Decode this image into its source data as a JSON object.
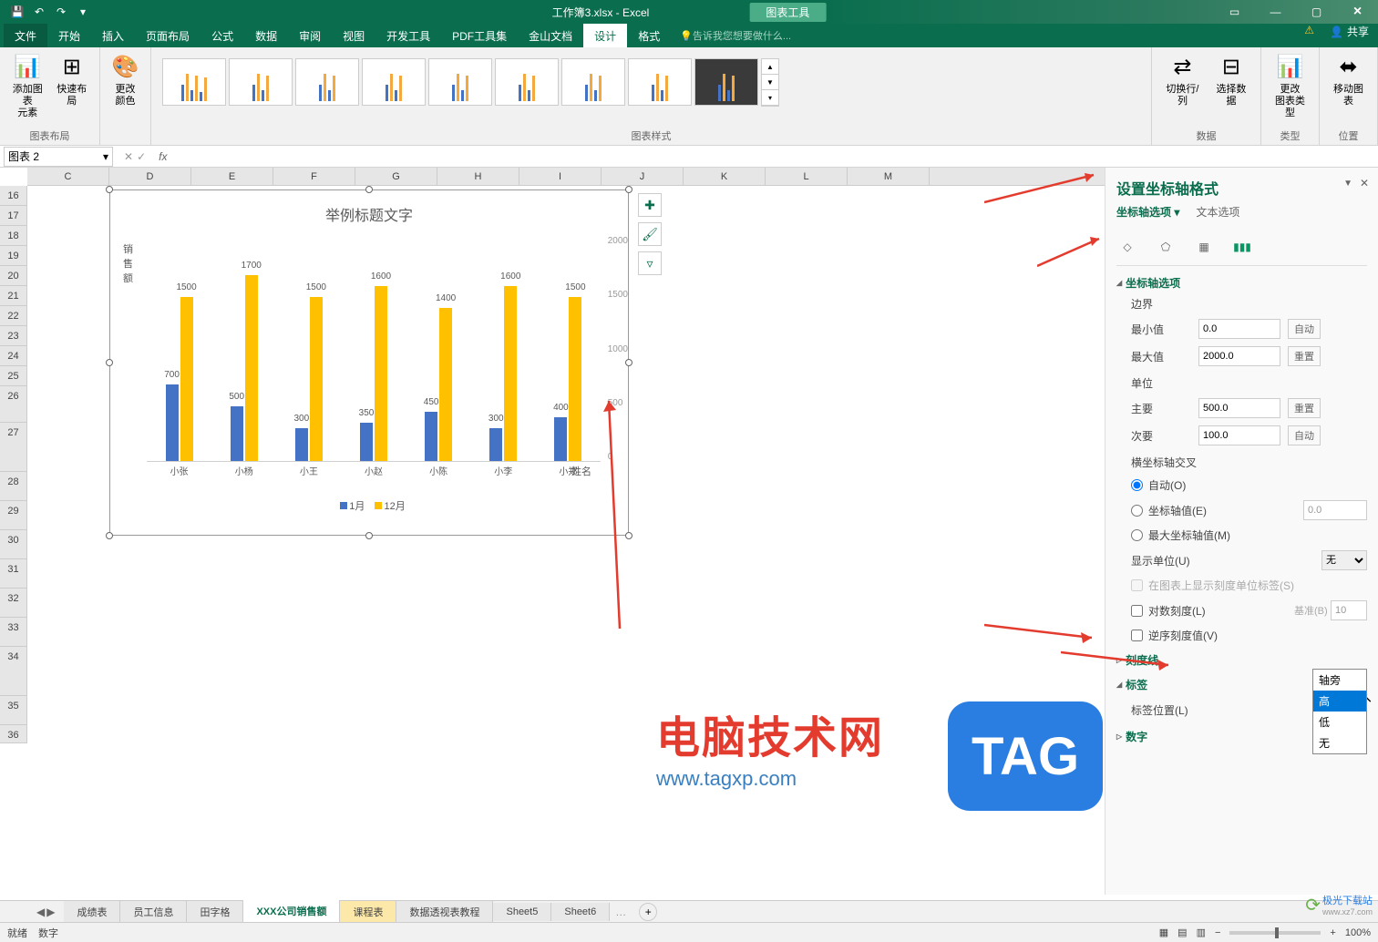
{
  "title_bar": {
    "file_name": "工作簿3.xlsx - Excel",
    "context_tab": "图表工具"
  },
  "ribbon_tabs": [
    "文件",
    "开始",
    "插入",
    "页面布局",
    "公式",
    "数据",
    "审阅",
    "视图",
    "开发工具",
    "PDF工具集",
    "金山文档",
    "设计",
    "格式"
  ],
  "ribbon_active": "设计",
  "tell_me": "告诉我您想要做什么...",
  "share_label": "共享",
  "ribbon": {
    "add_element": "添加图表\n元素",
    "quick_layout": "快速布局",
    "change_color": "更改\n颜色",
    "group_layout": "图表布局",
    "group_style": "图表样式",
    "switch_rc": "切换行/列",
    "select_data": "选择数据",
    "group_data": "数据",
    "change_type": "更改\n图表类型",
    "group_type": "类型",
    "move_chart": "移动图表",
    "group_loc": "位置"
  },
  "name_box": "图表 2",
  "chart_data": {
    "type": "bar",
    "title": "举例标题文字",
    "ylabel": "销\n售\n额",
    "xlabel": "姓名",
    "categories": [
      "小张",
      "小杨",
      "小王",
      "小赵",
      "小陈",
      "小李",
      "小郑"
    ],
    "series": [
      {
        "name": "1月",
        "values": [
          700,
          500,
          300,
          350,
          450,
          300,
          400
        ],
        "color": "#4472c4"
      },
      {
        "name": "12月",
        "values": [
          1500,
          1700,
          1500,
          1600,
          1400,
          1600,
          1500
        ],
        "color": "#ffc000"
      }
    ],
    "ylim": [
      0,
      2000
    ],
    "yticks": [
      0,
      500,
      1000,
      1500,
      2000
    ]
  },
  "format_pane": {
    "title": "设置坐标轴格式",
    "subtab1": "坐标轴选项",
    "subtab2": "文本选项",
    "section_axis": "坐标轴选项",
    "bounds": "边界",
    "min": "最小值",
    "min_val": "0.0",
    "min_aux": "自动",
    "max": "最大值",
    "max_val": "2000.0",
    "max_aux": "重置",
    "unit": "单位",
    "major": "主要",
    "major_val": "500.0",
    "major_aux": "重置",
    "minor": "次要",
    "minor_val": "100.0",
    "minor_aux": "自动",
    "hcross": "横坐标轴交叉",
    "auto_o": "自动(O)",
    "axis_val_e": "坐标轴值(E)",
    "axis_val_e_val": "0.0",
    "max_axis_m": "最大坐标轴值(M)",
    "disp_unit": "显示单位(U)",
    "disp_unit_val": "无",
    "show_unit_on_chart": "在图表上显示刻度单位标签(S)",
    "log_scale": "对数刻度(L)",
    "log_base_lbl": "基准(B)",
    "log_base": "10",
    "rev_order": "逆序刻度值(V)",
    "section_ticks": "刻度线",
    "section_labels": "标签",
    "label_pos": "标签位置(L)",
    "label_pos_val": "高",
    "label_pos_opts": [
      "轴旁",
      "高",
      "低",
      "无"
    ],
    "section_number": "数字"
  },
  "sheet_tabs": [
    "成绩表",
    "员工信息",
    "田字格",
    "XXX公司销售额",
    "课程表",
    "数据透视表教程",
    "Sheet5",
    "Sheet6"
  ],
  "sheet_active": "XXX公司销售额",
  "status": {
    "ready": "就绪",
    "extra": "数字",
    "zoom": "100%"
  },
  "watermark": {
    "cn": "电脑技术网",
    "en": "www.tagxp.com",
    "tag": "TAG",
    "jg": "极光下载站",
    "jg_en": "www.xz7.com"
  },
  "col_headers": [
    "C",
    "D",
    "E",
    "F",
    "G",
    "H",
    "I",
    "J",
    "K",
    "L",
    "M"
  ],
  "row_headers": [
    "16",
    "17",
    "18",
    "19",
    "20",
    "21",
    "22",
    "23",
    "24",
    "25",
    "26",
    "27",
    "28",
    "29",
    "30",
    "31",
    "32",
    "33",
    "34",
    "35",
    "36"
  ]
}
